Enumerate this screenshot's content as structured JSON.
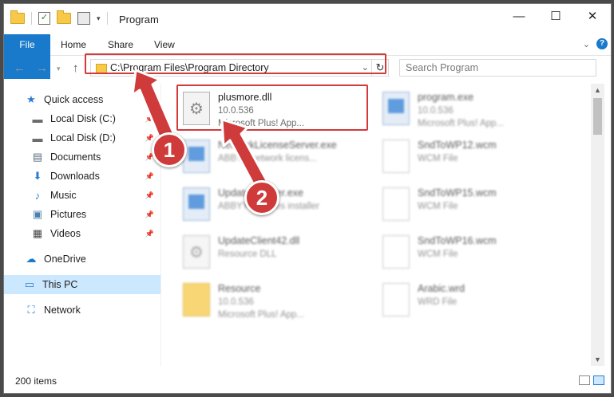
{
  "window": {
    "title": "Program",
    "controls": {
      "minimize": "—",
      "maximize": "☐",
      "close": "✕"
    }
  },
  "ribbon": {
    "tabs": [
      "File",
      "Home",
      "Share",
      "View"
    ],
    "collapse_icon": "chevron-down-icon",
    "help_label": "?"
  },
  "address": {
    "path": "C:\\Program Files\\Program Directory",
    "dropdown_glyph": "⌄",
    "refresh_glyph": "↻"
  },
  "search": {
    "placeholder": "Search Program"
  },
  "sidebar": {
    "items": [
      {
        "label": "Quick access",
        "icon": "star-icon",
        "glyph": "★",
        "color": "#2b7cd3",
        "pinned": false
      },
      {
        "label": "Local Disk (C:)",
        "icon": "drive-icon",
        "glyph": "▬",
        "color": "#6b6b6b",
        "pinned": true
      },
      {
        "label": "Local Disk (D:)",
        "icon": "drive-icon",
        "glyph": "▬",
        "color": "#6b6b6b",
        "pinned": true
      },
      {
        "label": "Documents",
        "icon": "documents-icon",
        "glyph": "▤",
        "color": "#5b6b7b",
        "pinned": true
      },
      {
        "label": "Downloads",
        "icon": "download-icon",
        "glyph": "⬇",
        "color": "#2b7cd3",
        "pinned": true
      },
      {
        "label": "Music",
        "icon": "music-icon",
        "glyph": "♪",
        "color": "#2b7cd3",
        "pinned": true
      },
      {
        "label": "Pictures",
        "icon": "pictures-icon",
        "glyph": "▣",
        "color": "#4a7fb0",
        "pinned": true
      },
      {
        "label": "Videos",
        "icon": "videos-icon",
        "glyph": "▦",
        "color": "#444444",
        "pinned": true
      },
      {
        "label": "OneDrive",
        "icon": "onedrive-icon",
        "glyph": "☁",
        "color": "#1979ca",
        "pinned": false
      },
      {
        "label": "This PC",
        "icon": "computer-icon",
        "glyph": "▭",
        "color": "#2b7cd3",
        "pinned": false
      },
      {
        "label": "Network",
        "icon": "network-icon",
        "glyph": "⛶",
        "color": "#2b7cd3",
        "pinned": false
      }
    ]
  },
  "files": [
    {
      "name": "plusmore.dll",
      "line1": "10.0.536",
      "line2": "Microsoft Plus! App...",
      "icon": "dll-file-icon"
    },
    {
      "name": "program.exe",
      "line1": "10.0.536",
      "line2": "Microsoft Plus! App...",
      "icon": "exe-file-icon"
    },
    {
      "name": "NetworkLicenseServer.exe",
      "line1": "ABBYY network licens...",
      "line2": "",
      "icon": "exe-file-icon"
    },
    {
      "name": "SndToWP12.wcm",
      "line1": "WCM File",
      "line2": "",
      "icon": "blank-file-icon"
    },
    {
      "name": "UpdateInstaller.exe",
      "line1": "ABBYY Updates installer",
      "line2": "",
      "icon": "exe-file-icon"
    },
    {
      "name": "SndToWP15.wcm",
      "line1": "WCM File",
      "line2": "",
      "icon": "blank-file-icon"
    },
    {
      "name": "UpdateClient42.dll",
      "line1": "Resource DLL",
      "line2": "",
      "icon": "dll-file-icon"
    },
    {
      "name": "SndToWP16.wcm",
      "line1": "WCM File",
      "line2": "",
      "icon": "blank-file-icon"
    },
    {
      "name": "Resource",
      "line1": "10.0.536",
      "line2": "Microsoft Plus! App...",
      "icon": "folder-icon"
    },
    {
      "name": "Arabic.wrd",
      "line1": "WRD File",
      "line2": "",
      "icon": "blank-file-icon"
    }
  ],
  "status": {
    "item_count": "200 items"
  },
  "annotations": [
    {
      "number": "1"
    },
    {
      "number": "2"
    }
  ],
  "colors": {
    "accent": "#1979ca",
    "highlight_red": "#d33a3a",
    "selected_bg": "#cce8ff"
  }
}
